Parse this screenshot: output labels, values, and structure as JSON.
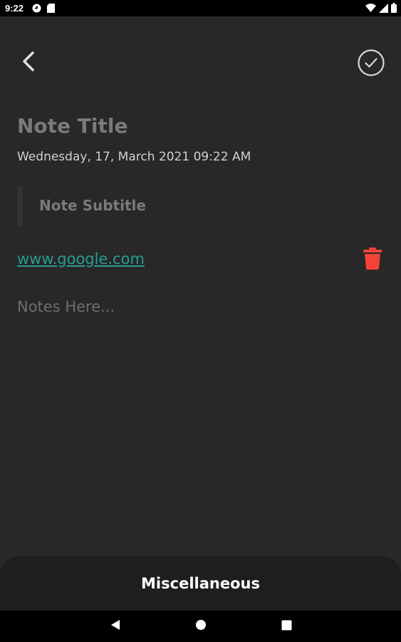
{
  "status_bar": {
    "time": "9:22",
    "icons": [
      "media-icon",
      "sd-card-icon",
      "wifi-icon",
      "signal-icon",
      "battery-icon"
    ]
  },
  "toolbar": {
    "back_icon": "chevron-left-icon",
    "save_icon": "check-circle-icon"
  },
  "note": {
    "title": "Note Title",
    "date": "Wednesday, 17, March 2021 09:22 AM",
    "subtitle": "Note Subtitle",
    "url": "www.google.com",
    "body_placeholder": "Notes Here..."
  },
  "misc_sheet": {
    "label": "Miscellaneous"
  },
  "colors": {
    "background": "#282828",
    "title": "#7a7a7a",
    "link": "#2a9d8f",
    "delete": "#f44336",
    "sheet": "#1e1e1e"
  },
  "nav": {
    "back_icon": "triangle-back-icon",
    "home_icon": "circle-home-icon",
    "recents_icon": "square-recents-icon"
  }
}
